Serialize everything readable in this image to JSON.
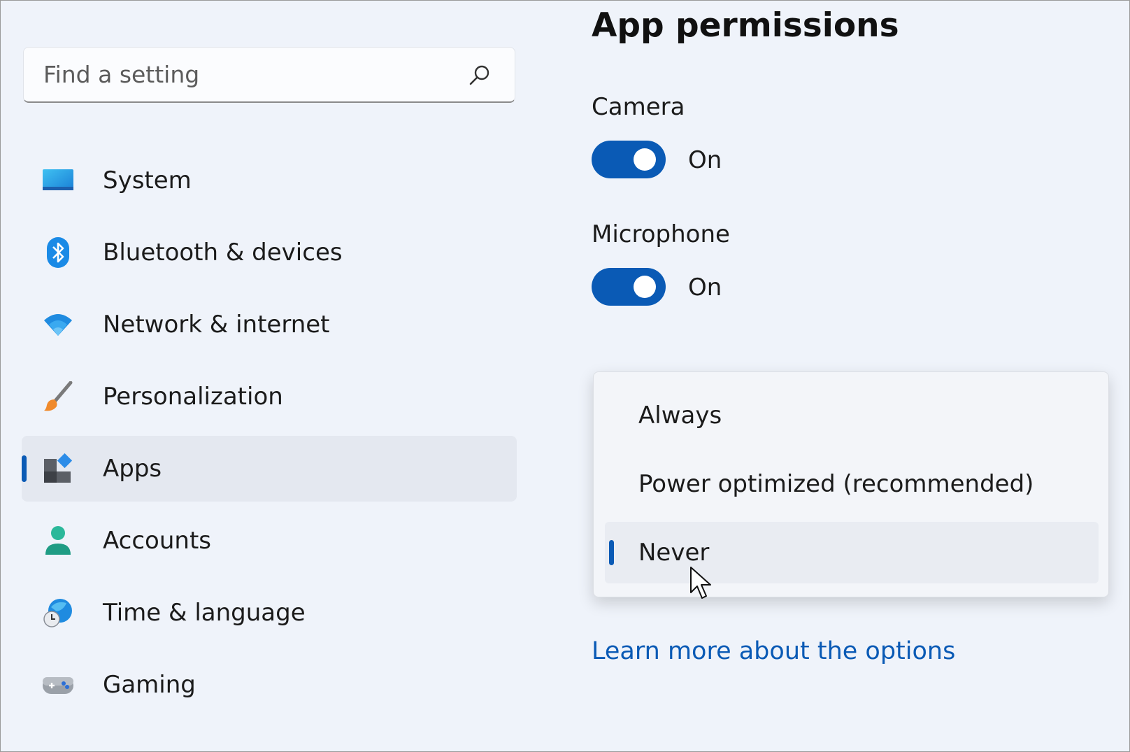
{
  "search": {
    "placeholder": "Find a setting"
  },
  "sidebar": {
    "items": [
      {
        "label": "System",
        "icon": "system-icon",
        "selected": false
      },
      {
        "label": "Bluetooth & devices",
        "icon": "bluetooth-icon",
        "selected": false
      },
      {
        "label": "Network & internet",
        "icon": "wifi-icon",
        "selected": false
      },
      {
        "label": "Personalization",
        "icon": "paintbrush-icon",
        "selected": false
      },
      {
        "label": "Apps",
        "icon": "apps-icon",
        "selected": true
      },
      {
        "label": "Accounts",
        "icon": "person-icon",
        "selected": false
      },
      {
        "label": "Time & language",
        "icon": "globe-clock-icon",
        "selected": false
      },
      {
        "label": "Gaming",
        "icon": "gamepad-icon",
        "selected": false
      }
    ]
  },
  "main": {
    "title": "App permissions",
    "camera": {
      "label": "Camera",
      "state": "On",
      "on": true
    },
    "microphone": {
      "label": "Microphone",
      "state": "On",
      "on": true
    },
    "dropdown": {
      "options": [
        "Always",
        "Power optimized (recommended)",
        "Never"
      ],
      "selected": "Never"
    },
    "learn_more": "Learn more about the options"
  },
  "colors": {
    "accent": "#0a5ab5",
    "background": "#eff3fa"
  }
}
